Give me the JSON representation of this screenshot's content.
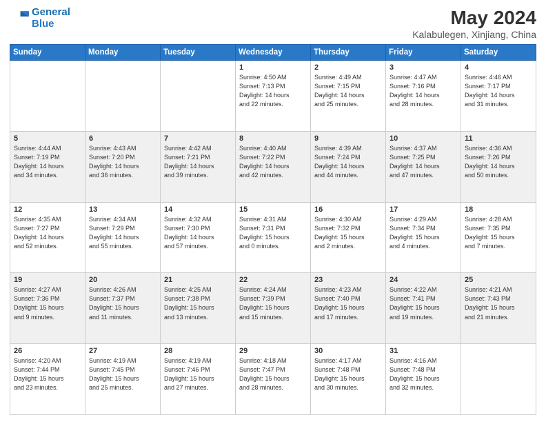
{
  "logo": {
    "line1": "General",
    "line2": "Blue"
  },
  "title": {
    "month_year": "May 2024",
    "location": "Kalabulegen, Xinjiang, China"
  },
  "days_of_week": [
    "Sunday",
    "Monday",
    "Tuesday",
    "Wednesday",
    "Thursday",
    "Friday",
    "Saturday"
  ],
  "weeks": [
    [
      {
        "num": "",
        "info": ""
      },
      {
        "num": "",
        "info": ""
      },
      {
        "num": "",
        "info": ""
      },
      {
        "num": "1",
        "info": "Sunrise: 4:50 AM\nSunset: 7:13 PM\nDaylight: 14 hours\nand 22 minutes."
      },
      {
        "num": "2",
        "info": "Sunrise: 4:49 AM\nSunset: 7:15 PM\nDaylight: 14 hours\nand 25 minutes."
      },
      {
        "num": "3",
        "info": "Sunrise: 4:47 AM\nSunset: 7:16 PM\nDaylight: 14 hours\nand 28 minutes."
      },
      {
        "num": "4",
        "info": "Sunrise: 4:46 AM\nSunset: 7:17 PM\nDaylight: 14 hours\nand 31 minutes."
      }
    ],
    [
      {
        "num": "5",
        "info": "Sunrise: 4:44 AM\nSunset: 7:19 PM\nDaylight: 14 hours\nand 34 minutes."
      },
      {
        "num": "6",
        "info": "Sunrise: 4:43 AM\nSunset: 7:20 PM\nDaylight: 14 hours\nand 36 minutes."
      },
      {
        "num": "7",
        "info": "Sunrise: 4:42 AM\nSunset: 7:21 PM\nDaylight: 14 hours\nand 39 minutes."
      },
      {
        "num": "8",
        "info": "Sunrise: 4:40 AM\nSunset: 7:22 PM\nDaylight: 14 hours\nand 42 minutes."
      },
      {
        "num": "9",
        "info": "Sunrise: 4:39 AM\nSunset: 7:24 PM\nDaylight: 14 hours\nand 44 minutes."
      },
      {
        "num": "10",
        "info": "Sunrise: 4:37 AM\nSunset: 7:25 PM\nDaylight: 14 hours\nand 47 minutes."
      },
      {
        "num": "11",
        "info": "Sunrise: 4:36 AM\nSunset: 7:26 PM\nDaylight: 14 hours\nand 50 minutes."
      }
    ],
    [
      {
        "num": "12",
        "info": "Sunrise: 4:35 AM\nSunset: 7:27 PM\nDaylight: 14 hours\nand 52 minutes."
      },
      {
        "num": "13",
        "info": "Sunrise: 4:34 AM\nSunset: 7:29 PM\nDaylight: 14 hours\nand 55 minutes."
      },
      {
        "num": "14",
        "info": "Sunrise: 4:32 AM\nSunset: 7:30 PM\nDaylight: 14 hours\nand 57 minutes."
      },
      {
        "num": "15",
        "info": "Sunrise: 4:31 AM\nSunset: 7:31 PM\nDaylight: 15 hours\nand 0 minutes."
      },
      {
        "num": "16",
        "info": "Sunrise: 4:30 AM\nSunset: 7:32 PM\nDaylight: 15 hours\nand 2 minutes."
      },
      {
        "num": "17",
        "info": "Sunrise: 4:29 AM\nSunset: 7:34 PM\nDaylight: 15 hours\nand 4 minutes."
      },
      {
        "num": "18",
        "info": "Sunrise: 4:28 AM\nSunset: 7:35 PM\nDaylight: 15 hours\nand 7 minutes."
      }
    ],
    [
      {
        "num": "19",
        "info": "Sunrise: 4:27 AM\nSunset: 7:36 PM\nDaylight: 15 hours\nand 9 minutes."
      },
      {
        "num": "20",
        "info": "Sunrise: 4:26 AM\nSunset: 7:37 PM\nDaylight: 15 hours\nand 11 minutes."
      },
      {
        "num": "21",
        "info": "Sunrise: 4:25 AM\nSunset: 7:38 PM\nDaylight: 15 hours\nand 13 minutes."
      },
      {
        "num": "22",
        "info": "Sunrise: 4:24 AM\nSunset: 7:39 PM\nDaylight: 15 hours\nand 15 minutes."
      },
      {
        "num": "23",
        "info": "Sunrise: 4:23 AM\nSunset: 7:40 PM\nDaylight: 15 hours\nand 17 minutes."
      },
      {
        "num": "24",
        "info": "Sunrise: 4:22 AM\nSunset: 7:41 PM\nDaylight: 15 hours\nand 19 minutes."
      },
      {
        "num": "25",
        "info": "Sunrise: 4:21 AM\nSunset: 7:43 PM\nDaylight: 15 hours\nand 21 minutes."
      }
    ],
    [
      {
        "num": "26",
        "info": "Sunrise: 4:20 AM\nSunset: 7:44 PM\nDaylight: 15 hours\nand 23 minutes."
      },
      {
        "num": "27",
        "info": "Sunrise: 4:19 AM\nSunset: 7:45 PM\nDaylight: 15 hours\nand 25 minutes."
      },
      {
        "num": "28",
        "info": "Sunrise: 4:19 AM\nSunset: 7:46 PM\nDaylight: 15 hours\nand 27 minutes."
      },
      {
        "num": "29",
        "info": "Sunrise: 4:18 AM\nSunset: 7:47 PM\nDaylight: 15 hours\nand 28 minutes."
      },
      {
        "num": "30",
        "info": "Sunrise: 4:17 AM\nSunset: 7:48 PM\nDaylight: 15 hours\nand 30 minutes."
      },
      {
        "num": "31",
        "info": "Sunrise: 4:16 AM\nSunset: 7:48 PM\nDaylight: 15 hours\nand 32 minutes."
      },
      {
        "num": "",
        "info": ""
      }
    ]
  ]
}
